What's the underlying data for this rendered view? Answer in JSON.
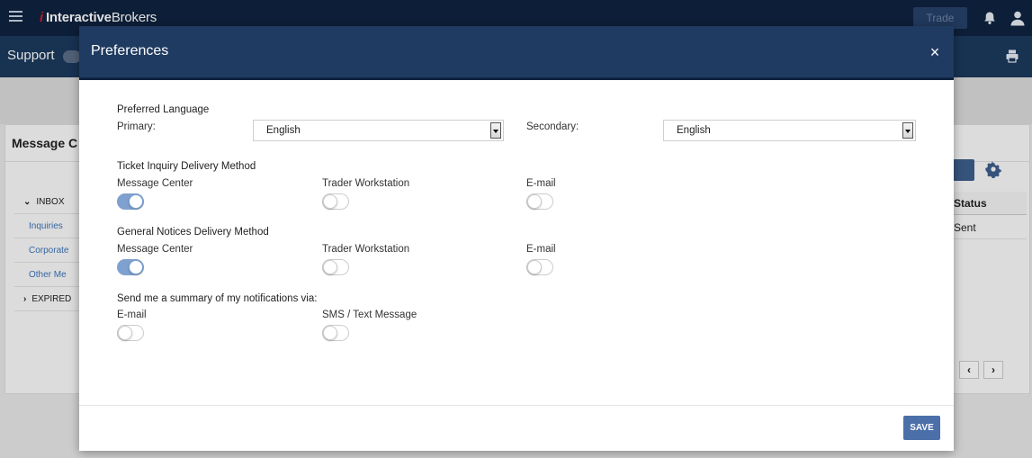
{
  "app": {
    "brand": {
      "mark": "i",
      "bold": "Interactive",
      "light": "Brokers"
    },
    "trade_label": "Trade",
    "section_label": "Support"
  },
  "message_center": {
    "title": "Message C",
    "nav": [
      {
        "label": "INBOX",
        "kind": "header",
        "chevron": "⌄"
      },
      {
        "label": "Inquiries",
        "kind": "link"
      },
      {
        "label": "Corporate",
        "kind": "link"
      },
      {
        "label": "Other Me",
        "kind": "link"
      },
      {
        "label": "EXPIRED",
        "kind": "header",
        "chevron": "›"
      }
    ],
    "table": {
      "status_header": "Status",
      "status_value": "Sent"
    },
    "pager": {
      "prev": "‹",
      "next": "›"
    }
  },
  "modal": {
    "title": "Preferences",
    "close_label": "×",
    "language": {
      "heading": "Preferred Language",
      "primary_label": "Primary:",
      "primary_value": "English",
      "secondary_label": "Secondary:",
      "secondary_value": "English"
    },
    "ticket": {
      "heading": "Ticket Inquiry Delivery Method",
      "options": [
        {
          "label": "Message Center",
          "on": true
        },
        {
          "label": "Trader Workstation",
          "on": false
        },
        {
          "label": "E-mail",
          "on": false
        }
      ]
    },
    "notices": {
      "heading": "General Notices Delivery Method",
      "options": [
        {
          "label": "Message Center",
          "on": true
        },
        {
          "label": "Trader Workstation",
          "on": false
        },
        {
          "label": "E-mail",
          "on": false
        }
      ]
    },
    "summary": {
      "heading": "Send me a summary of my notifications via:",
      "options": [
        {
          "label": "E-mail",
          "on": false
        },
        {
          "label": "SMS / Text Message",
          "on": false
        }
      ]
    },
    "save_label": "SAVE"
  },
  "colors": {
    "topbar": "#0f2340",
    "modal_header": "#1f3b61",
    "toggle_on": "#7ea1cf",
    "save_button": "#4b6fa8"
  }
}
